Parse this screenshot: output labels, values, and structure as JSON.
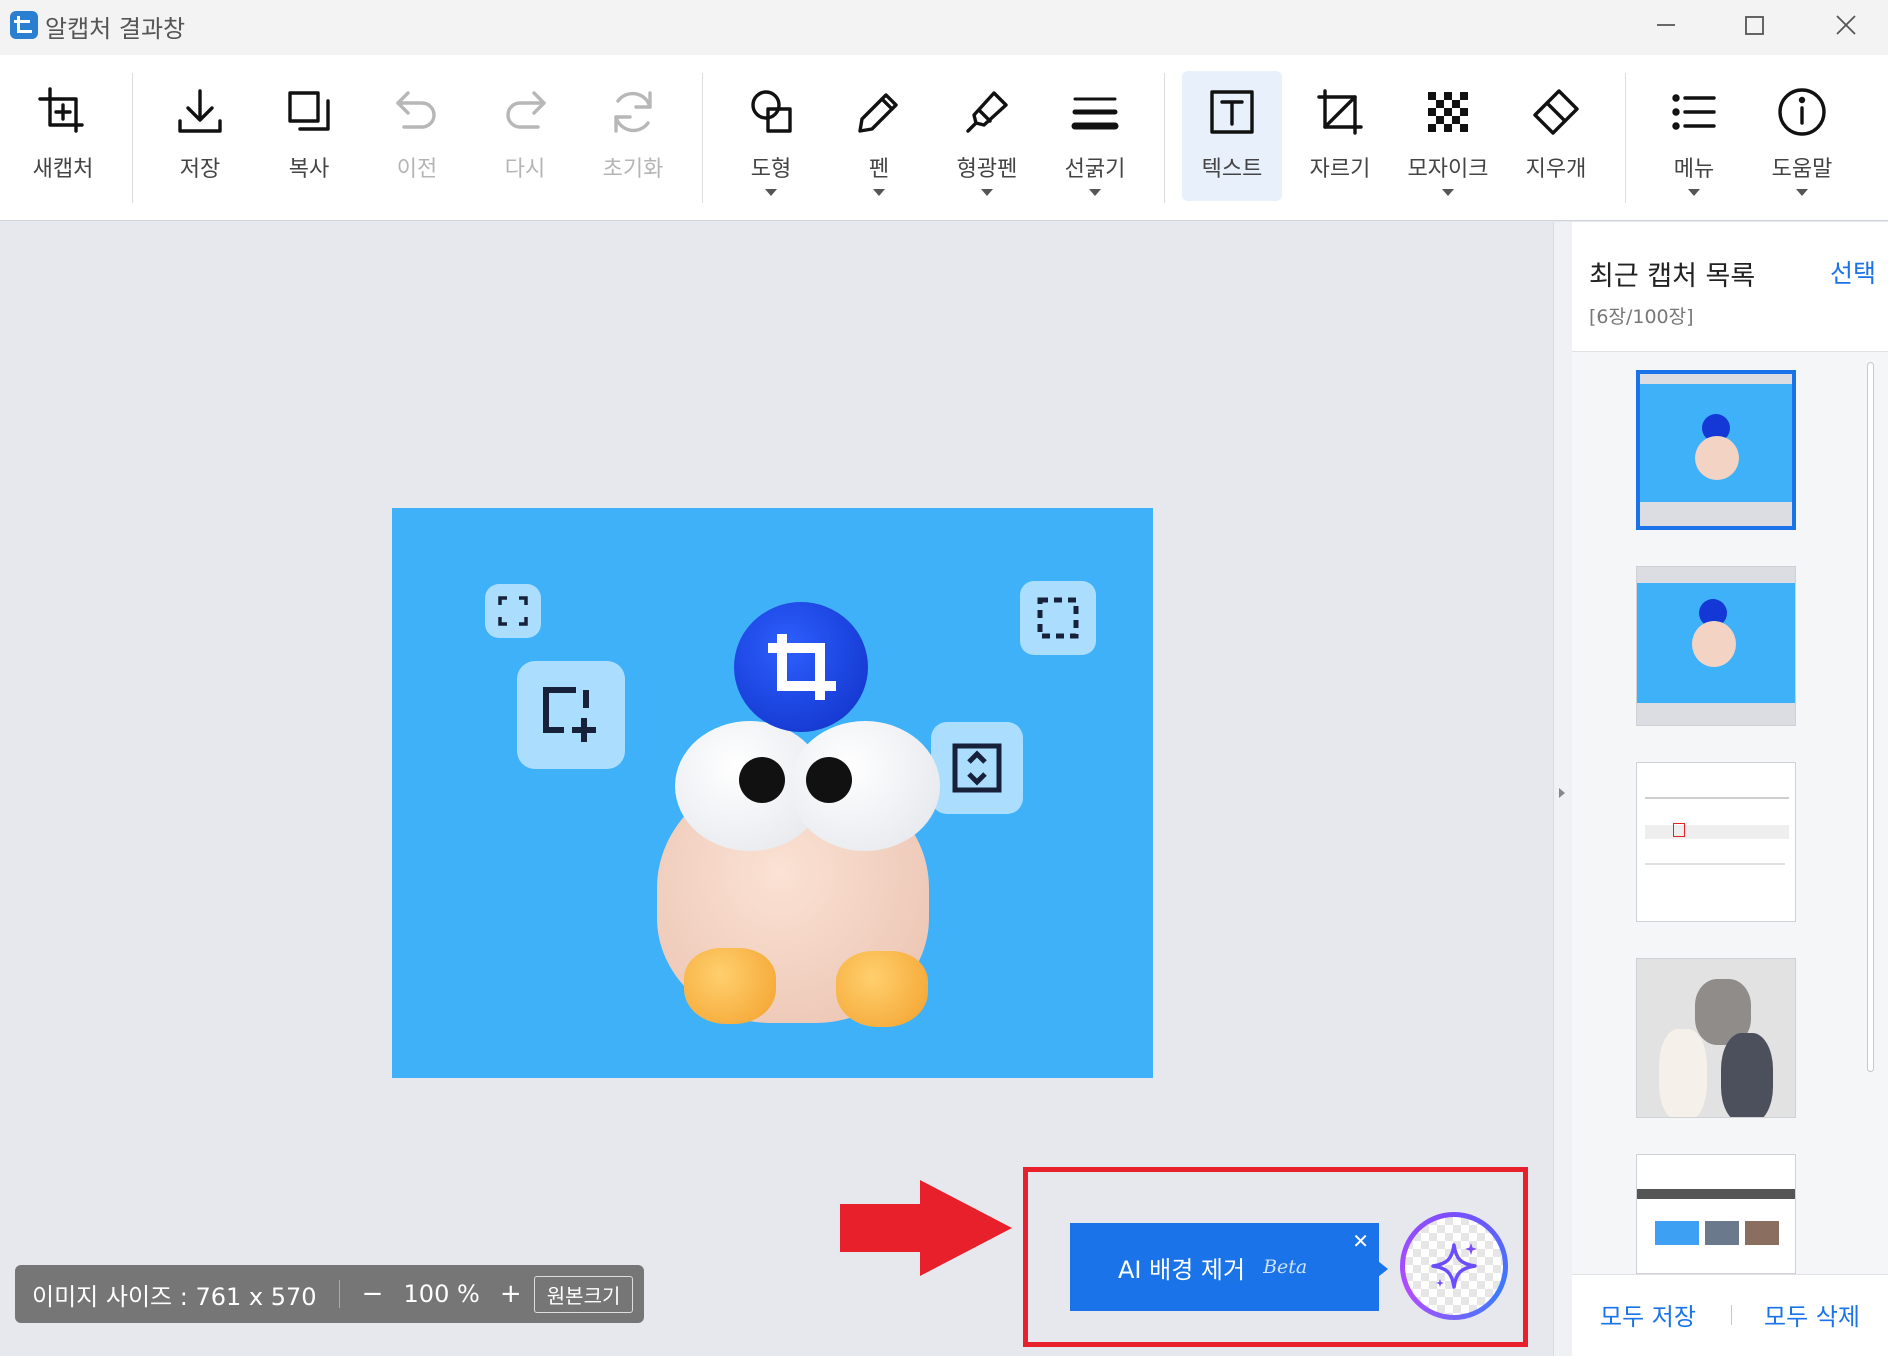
{
  "window": {
    "title": "알캡처 결과창"
  },
  "toolbar": {
    "new_capture": "새캡처",
    "save": "저장",
    "copy": "복사",
    "undo": "이전",
    "redo": "다시",
    "reset": "초기화",
    "shape": "도형",
    "pen": "펜",
    "highlighter": "형광펜",
    "line_width": "선굵기",
    "text": "텍스트",
    "crop": "자르기",
    "mosaic": "모자이크",
    "eraser": "지우개",
    "menu": "메뉴",
    "help": "도움말"
  },
  "canvas": {
    "image_size_label": "이미지 사이즈 : 761 x 570",
    "zoom_out": "−",
    "zoom_level": "100 %",
    "zoom_in": "+",
    "original_size": "원본크기"
  },
  "ai_bg": {
    "label": "AI 배경 제거",
    "beta": "Beta",
    "close": "✕"
  },
  "panel": {
    "title": "최근 캡처 목록",
    "select": "선택",
    "count": "[6장/100장]",
    "save_all": "모두 저장",
    "delete_all": "모두 삭제"
  },
  "colors": {
    "accent": "#1a73e8",
    "capture_bg": "#3fb1f9",
    "highlight_frame": "#e8202c",
    "arrow": "#e8202c"
  }
}
